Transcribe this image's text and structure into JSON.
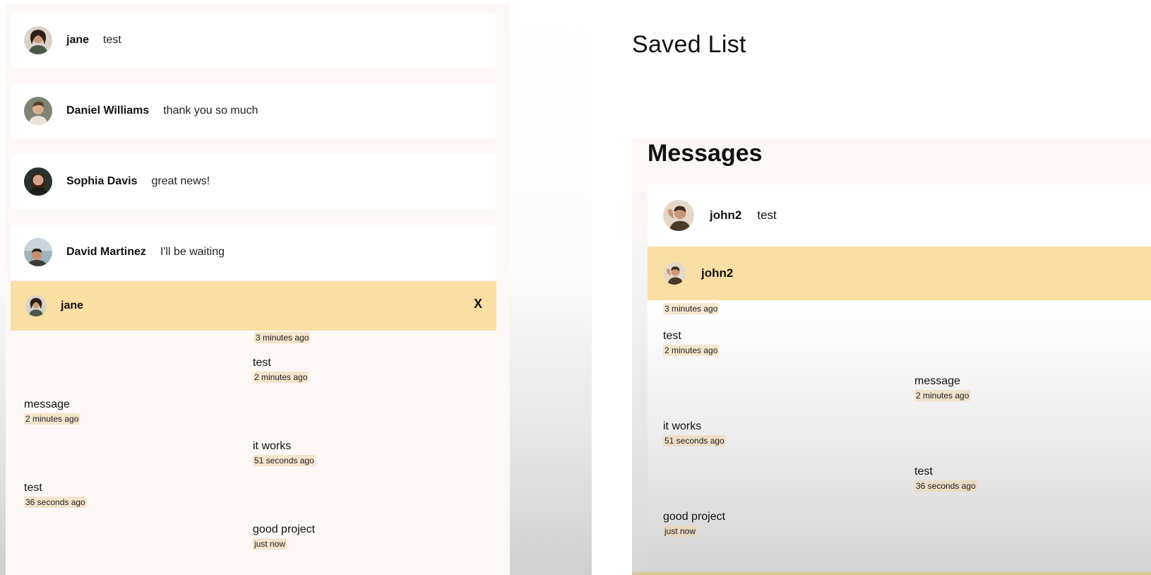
{
  "left": {
    "conversations": [
      {
        "name": "jane",
        "preview": "test",
        "avatar_icon": "jane-avatar"
      },
      {
        "name": "Daniel Williams",
        "preview": "thank you so much",
        "avatar_icon": "daniel-avatar"
      },
      {
        "name": "Sophia Davis",
        "preview": "great news!",
        "avatar_icon": "sophia-avatar"
      },
      {
        "name": "David Martinez",
        "preview": "I'll be waiting",
        "avatar_icon": "david-avatar"
      }
    ],
    "chat": {
      "name": "jane",
      "close_label": "X",
      "messages": [
        {
          "text": "",
          "time": "3 minutes ago",
          "side": "right"
        },
        {
          "text": "test",
          "time": "2 minutes ago",
          "side": "right"
        },
        {
          "text": "message",
          "time": "2 minutes ago",
          "side": "left"
        },
        {
          "text": "it works",
          "time": "51 seconds ago",
          "side": "right"
        },
        {
          "text": "test",
          "time": "36 seconds ago",
          "side": "left"
        },
        {
          "text": "good project",
          "time": "just now",
          "side": "right"
        }
      ]
    }
  },
  "right": {
    "saved_title": "Saved List",
    "messages_title": "Messages",
    "conversation": {
      "name": "john2",
      "preview": "test"
    },
    "chat": {
      "name": "john2",
      "messages": [
        {
          "text": "",
          "time": "3 minutes ago",
          "side": "left"
        },
        {
          "text": "test",
          "time": "2 minutes ago",
          "side": "left"
        },
        {
          "text": "message",
          "time": "2 minutes ago",
          "side": "right"
        },
        {
          "text": "it works",
          "time": "51 seconds ago",
          "side": "left"
        },
        {
          "text": "test",
          "time": "36 seconds ago",
          "side": "right"
        },
        {
          "text": "good project",
          "time": "just now",
          "side": "left"
        }
      ]
    }
  },
  "colors": {
    "highlight": "#fadfa4",
    "timestamp_bg": "#ecd6aa",
    "panel_bg": "#fdf7f5"
  }
}
